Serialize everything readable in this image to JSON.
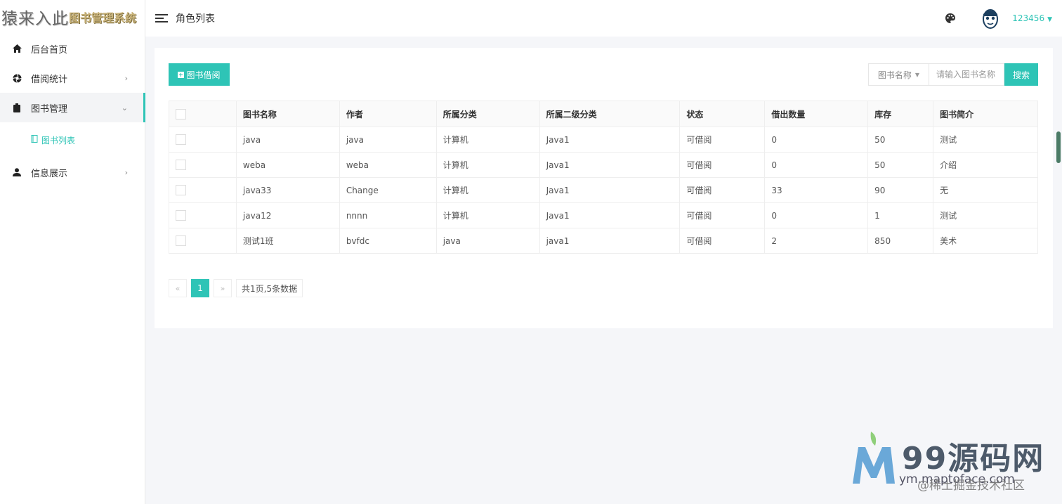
{
  "logo": {
    "main": "猿来入此",
    "sub": "图书管理系统"
  },
  "sidebar": {
    "items": [
      {
        "label": "后台首页",
        "icon": "home-icon"
      },
      {
        "label": "借阅统计",
        "icon": "aperture-icon",
        "arrow": "›"
      },
      {
        "label": "图书管理",
        "icon": "clipboard-icon",
        "arrow": "⌄",
        "open": true
      },
      {
        "label": "信息展示",
        "icon": "user-icon",
        "arrow": "›"
      }
    ],
    "sub_items": [
      {
        "label": "图书列表",
        "icon": "book-icon"
      }
    ]
  },
  "header": {
    "title": "角色列表",
    "username": "123456"
  },
  "toolbar": {
    "borrow_label": "图书借阅",
    "search_select": "图书名称",
    "search_placeholder": "请输入图书名称",
    "search_label": "搜索"
  },
  "table": {
    "columns": [
      "图书名称",
      "作者",
      "所属分类",
      "所属二级分类",
      "状态",
      "借出数量",
      "库存",
      "图书简介"
    ],
    "rows": [
      [
        "java",
        "java",
        "计算机",
        "Java1",
        "可借阅",
        "0",
        "50",
        "测试"
      ],
      [
        "weba",
        "weba",
        "计算机",
        "Java1",
        "可借阅",
        "0",
        "50",
        "介绍"
      ],
      [
        "java33",
        "Change",
        "计算机",
        "Java1",
        "可借阅",
        "33",
        "90",
        "无"
      ],
      [
        "java12",
        "nnnn",
        "计算机",
        "Java1",
        "可借阅",
        "0",
        "1",
        "测试"
      ],
      [
        "测试1班",
        "bvfdc",
        "java",
        "java1",
        "可借阅",
        "2",
        "850",
        "美术"
      ]
    ]
  },
  "pager": {
    "prev": "«",
    "current": "1",
    "next": "»",
    "info": "共1页,5条数据"
  },
  "watermark": {
    "brand": "99源码网",
    "url": "ym.maptoface.com",
    "community": "@稀土掘金技术社区"
  },
  "colors": {
    "accent": "#2ec4b6"
  }
}
